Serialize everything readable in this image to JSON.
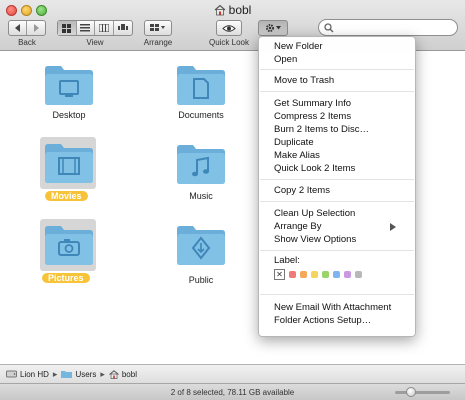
{
  "window": {
    "title": "bobl"
  },
  "toolbar": {
    "back_label": "Back",
    "view_label": "View",
    "arrange_label": "Arrange",
    "quicklook_label": "Quick Look",
    "search_placeholder": ""
  },
  "files": [
    {
      "name": "Desktop",
      "selected": false,
      "icon": "desktop-folder-icon"
    },
    {
      "name": "Documents",
      "selected": false,
      "icon": "documents-folder-icon"
    },
    {
      "name": "Movies",
      "selected": true,
      "icon": "movies-folder-icon"
    },
    {
      "name": "Music",
      "selected": false,
      "icon": "music-folder-icon"
    },
    {
      "name": "Pictures",
      "selected": true,
      "icon": "pictures-folder-icon"
    },
    {
      "name": "Public",
      "selected": false,
      "icon": "public-folder-icon"
    }
  ],
  "menu": {
    "items": [
      "New Folder",
      "Open",
      "Move to Trash",
      "Get Summary Info",
      "Compress 2 Items",
      "Burn 2 Items to Disc…",
      "Duplicate",
      "Make Alias",
      "Quick Look 2 Items",
      "Copy 2 Items",
      "Clean Up Selection",
      "Arrange By",
      "Show View Options",
      "Label:",
      "New Email With Attachment",
      "Folder Actions Setup…"
    ],
    "label_colors": [
      "#f07a7a",
      "#f5a85a",
      "#f3d55b",
      "#9ad46a",
      "#7fb6ef",
      "#c99ae0",
      "#b8b8b8"
    ]
  },
  "pathbar": {
    "crumbs": [
      "Lion HD",
      "Users",
      "bobl"
    ]
  },
  "status": {
    "text": "2 of 8 selected, 78.11 GB available",
    "zoom_fraction": 0.25
  },
  "colors": {
    "folder_blue": "#74b6de",
    "selection_yellow": "#f6c339"
  }
}
